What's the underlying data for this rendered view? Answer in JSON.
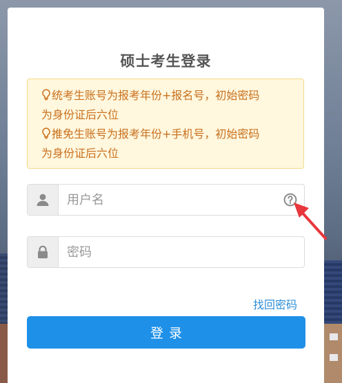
{
  "login": {
    "title": "硕士考生登录",
    "notice": {
      "line1": "统考生账号为报考年份+报名号，初始密码",
      "line2": "为身份证后六位",
      "line3": "推免生账号为报考年份+手机号，初始密码",
      "line4": "为身份证后六位",
      "icon": "lightbulb-icon"
    },
    "username": {
      "placeholder": "用户名",
      "value": "",
      "icon": "user-icon",
      "help_icon": "question-circle-icon"
    },
    "password": {
      "placeholder": "密码",
      "value": "",
      "icon": "lock-icon"
    },
    "forgot_password": "找回密码",
    "submit_label": "登录"
  },
  "colors": {
    "primary": "#1e90e8",
    "link": "#2f8fd8",
    "notice_text": "#c8701d",
    "notice_bg": "#fff7de",
    "notice_border": "#f3d98a",
    "annotation_arrow": "#e8373d"
  }
}
